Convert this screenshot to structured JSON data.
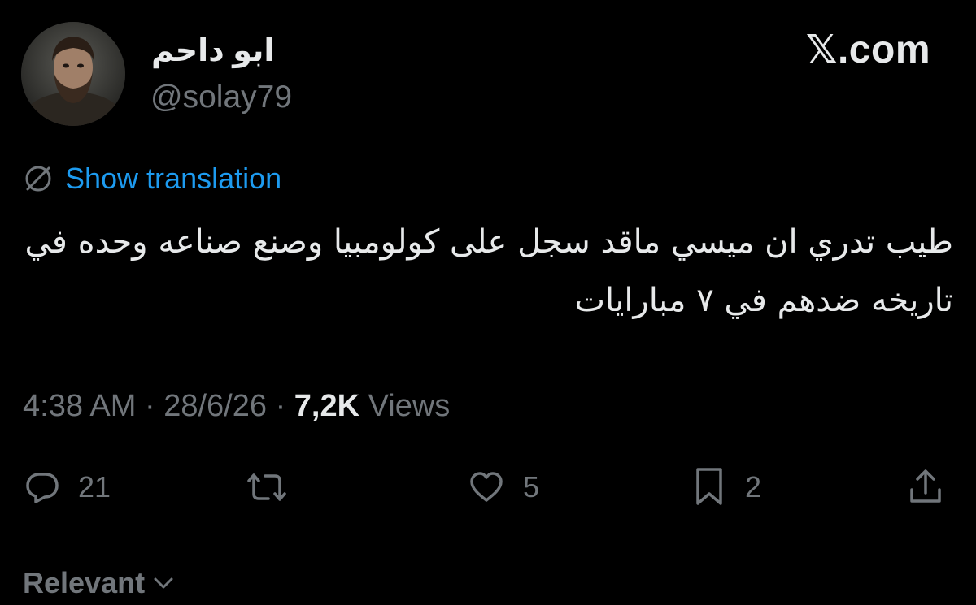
{
  "user": {
    "display_name": "ابو داحم",
    "handle": "@solay79"
  },
  "brand": "𝕏.com",
  "translate": {
    "icon": "globe-icon",
    "label": "Show translation"
  },
  "tweet": {
    "text": "طيب تدري ان ميسي ماقد سجل على كولومبيا وصنع صناعه وحده في تاريخه ضدهم في ٧ مبارايات"
  },
  "meta": {
    "time": "4:38 AM",
    "separator": "·",
    "date": "28/6/26",
    "views_count": "7,2K",
    "views_label": "Views"
  },
  "actions": {
    "reply": {
      "icon": "reply-icon",
      "count": "21"
    },
    "repost": {
      "icon": "repost-icon",
      "count": ""
    },
    "like": {
      "icon": "heart-icon",
      "count": "5"
    },
    "bookmark": {
      "icon": "bookmark-icon",
      "count": "2"
    },
    "share": {
      "icon": "share-icon"
    }
  },
  "sort": {
    "label": "Relevant",
    "icon": "chevron-down-icon"
  },
  "colors": {
    "background": "#000000",
    "text_primary": "#e7e9ea",
    "text_secondary": "#71767b",
    "link": "#1d9bf0"
  }
}
